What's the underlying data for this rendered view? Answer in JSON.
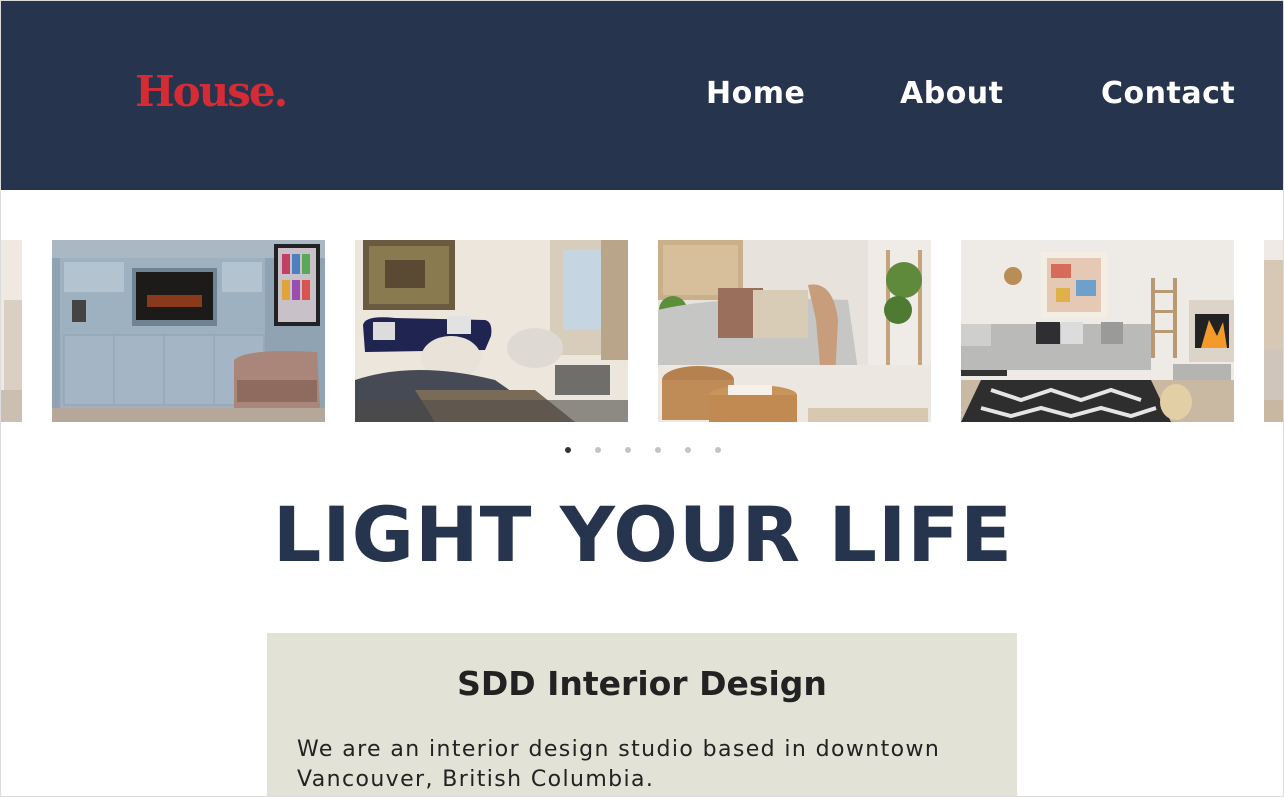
{
  "brand": {
    "logo_text": "House.",
    "logo_color": "#d42b35"
  },
  "nav": {
    "items": [
      {
        "label": "Home"
      },
      {
        "label": "About"
      },
      {
        "label": "Contact"
      }
    ],
    "background": "#27344d"
  },
  "carousel": {
    "slides": [
      {
        "alt": "partial-room-image"
      },
      {
        "alt": "blue-cabinet-living-room"
      },
      {
        "alt": "navy-sofa-living-room"
      },
      {
        "alt": "grey-sofa-cushions"
      },
      {
        "alt": "fireplace-living-room"
      },
      {
        "alt": "partial-room-image"
      }
    ],
    "dot_count": 6,
    "active_dot": 0
  },
  "hero": {
    "title": "LIGHT YOUR LIFE",
    "title_color": "#27344d"
  },
  "about": {
    "heading": "SDD Interior Design",
    "description": "We are an interior design studio based in downtown Vancouver, British Columbia.",
    "background": "#e2e2d6"
  }
}
